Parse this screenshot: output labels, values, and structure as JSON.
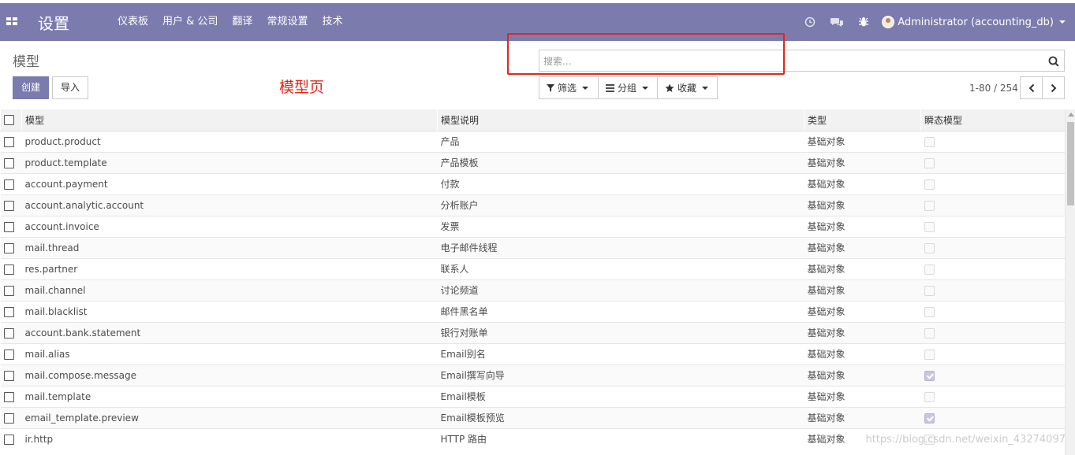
{
  "navbar": {
    "app_title": "设置",
    "menu": [
      "仪表板",
      "用户 & 公司",
      "翻译",
      "常规设置",
      "技术"
    ],
    "systray": [
      "clock-icon",
      "chat-icon",
      "bug-icon"
    ],
    "user": "Administrator (accounting_db)",
    "color": "#7c7bad"
  },
  "control_panel": {
    "breadcrumb": "模型",
    "create_label": "创建",
    "import_label": "导入",
    "annotation": "模型页",
    "search_placeholder": "搜索...",
    "filters_label": "筛选",
    "groupby_label": "分组",
    "favorites_label": "收藏",
    "pager": "1-80 / 254"
  },
  "list": {
    "columns": [
      "模型",
      "模型说明",
      "类型",
      "瞬态模型"
    ],
    "rows": [
      {
        "model": "product.product",
        "desc": "产品",
        "type": "基础对象",
        "transient": false
      },
      {
        "model": "product.template",
        "desc": "产品模板",
        "type": "基础对象",
        "transient": false
      },
      {
        "model": "account.payment",
        "desc": "付款",
        "type": "基础对象",
        "transient": false
      },
      {
        "model": "account.analytic.account",
        "desc": "分析账户",
        "type": "基础对象",
        "transient": false
      },
      {
        "model": "account.invoice",
        "desc": "发票",
        "type": "基础对象",
        "transient": false
      },
      {
        "model": "mail.thread",
        "desc": "电子邮件线程",
        "type": "基础对象",
        "transient": false
      },
      {
        "model": "res.partner",
        "desc": "联系人",
        "type": "基础对象",
        "transient": false
      },
      {
        "model": "mail.channel",
        "desc": "讨论频道",
        "type": "基础对象",
        "transient": false
      },
      {
        "model": "mail.blacklist",
        "desc": "邮件黑名单",
        "type": "基础对象",
        "transient": false
      },
      {
        "model": "account.bank.statement",
        "desc": "银行对账单",
        "type": "基础对象",
        "transient": false
      },
      {
        "model": "mail.alias",
        "desc": "Email别名",
        "type": "基础对象",
        "transient": false
      },
      {
        "model": "mail.compose.message",
        "desc": "Email撰写向导",
        "type": "基础对象",
        "transient": true
      },
      {
        "model": "mail.template",
        "desc": "Email模板",
        "type": "基础对象",
        "transient": false
      },
      {
        "model": "email_template.preview",
        "desc": "Email模板预览",
        "type": "基础对象",
        "transient": true
      },
      {
        "model": "ir.http",
        "desc": "HTTP 路由",
        "type": "基础对象",
        "transient": false
      }
    ]
  },
  "watermark": "https://blog.csdn.net/weixin_43274097"
}
